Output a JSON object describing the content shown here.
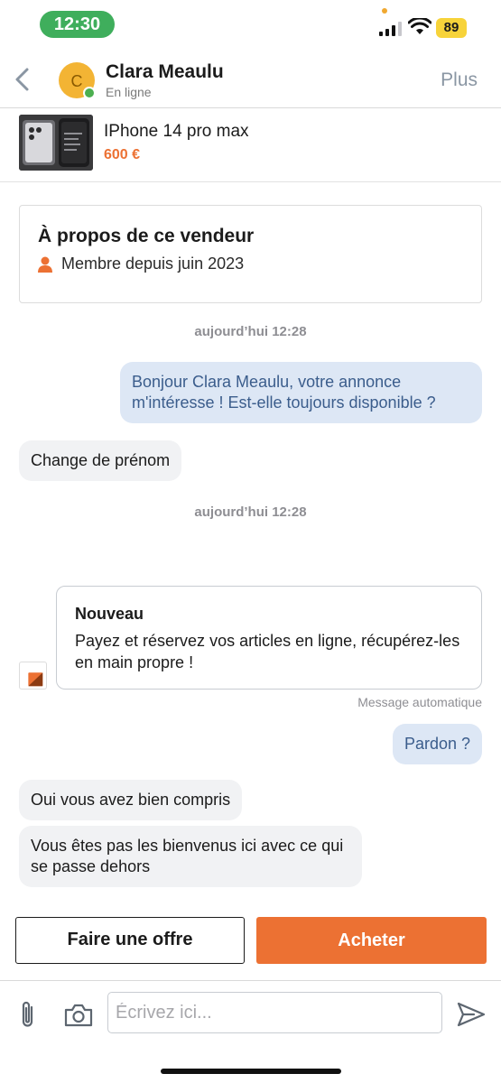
{
  "status_bar": {
    "time": "12:30",
    "battery": "89"
  },
  "header": {
    "contact_name": "Clara Meaulu",
    "avatar_initial": "C",
    "status": "En ligne",
    "more_label": "Plus"
  },
  "product": {
    "title": "IPhone 14 pro max",
    "price": "600 €"
  },
  "seller_card": {
    "title": "À propos de ce vendeur",
    "member_since": "Membre depuis juin 2023"
  },
  "messages": [
    {
      "type": "timestamp",
      "text": "aujourd’hui 12:28"
    },
    {
      "type": "outgoing",
      "text": "Bonjour Clara Meaulu, votre annonce m'intéresse ! Est-elle toujours disponible ?"
    },
    {
      "type": "incoming",
      "text": "Change de prénom"
    },
    {
      "type": "timestamp",
      "text": "aujourd’hui 12:28"
    },
    {
      "type": "outgoing",
      "text": "Pardon ?"
    },
    {
      "type": "incoming",
      "text": "Oui vous avez bien compris"
    },
    {
      "type": "incoming",
      "text": "Vous êtes pas les bienvenus ici avec ce qui se passe dehors"
    }
  ],
  "promo": {
    "title": "Nouveau",
    "body": "Payez et réservez vos articles en ligne, récupérez-les en main propre !",
    "footer": "Message automatique"
  },
  "actions": {
    "offer_label": "Faire une offre",
    "buy_label": "Acheter"
  },
  "composer": {
    "placeholder": "Écrivez ici..."
  },
  "colors": {
    "accent": "#ec7133",
    "outgoing_bubble": "#dde7f5",
    "incoming_bubble": "#f1f2f4",
    "online": "#4caf50"
  },
  "icons": [
    "back-chevron-icon",
    "person-icon",
    "paperclip-icon",
    "camera-icon",
    "send-icon",
    "signal-icon",
    "wifi-icon"
  ]
}
